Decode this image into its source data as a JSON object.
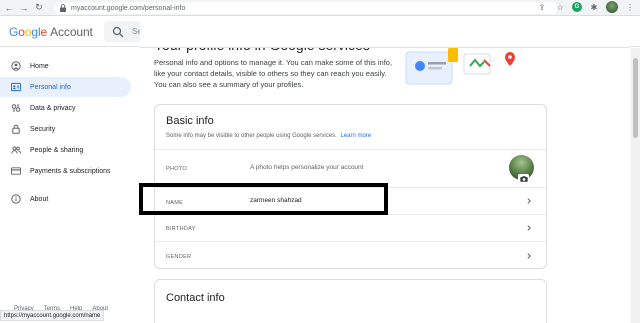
{
  "browser": {
    "url": "myaccount.google.com/personal-info",
    "status_url": "https://myaccount.google.com/name",
    "extension_letter": "G"
  },
  "header": {
    "logo_letters": [
      "G",
      "o",
      "o",
      "g",
      "l",
      "e"
    ],
    "logo_suffix": "Account",
    "search_placeholder": "Search Google Account"
  },
  "sidebar": {
    "items": [
      {
        "label": "Home",
        "icon": "home-icon"
      },
      {
        "label": "Personal info",
        "icon": "personal-info-icon",
        "active": true
      },
      {
        "label": "Data & privacy",
        "icon": "data-privacy-icon"
      },
      {
        "label": "Security",
        "icon": "lock-icon"
      },
      {
        "label": "People & sharing",
        "icon": "people-icon"
      },
      {
        "label": "Payments & subscriptions",
        "icon": "card-icon"
      },
      {
        "label": "About",
        "icon": "info-icon"
      }
    ],
    "footer": [
      "Privacy",
      "Terms",
      "Help",
      "About"
    ]
  },
  "main": {
    "title": "Your profile info in Google services",
    "intro": "Personal info and options to manage it. You can make some of this info, like your contact details, visible to others so they can reach you easily. You can also see a summary of your profiles.",
    "basic_info": {
      "title": "Basic info",
      "subtitle": "Some info may be visible to other people using Google services.",
      "learn_more": "Learn more",
      "rows": [
        {
          "label": "PHOTO",
          "value": "A photo helps personalize your account"
        },
        {
          "label": "NAME",
          "value": "zarmeen shahzad"
        },
        {
          "label": "BIRTHDAY",
          "value": ""
        },
        {
          "label": "GENDER",
          "value": ""
        }
      ]
    },
    "contact_info": {
      "title": "Contact info"
    }
  },
  "colors": {
    "accent": "#1a73e8",
    "active_bg": "#e8f0fe",
    "active_text": "#1967d2",
    "highlight_border": "#000000"
  }
}
